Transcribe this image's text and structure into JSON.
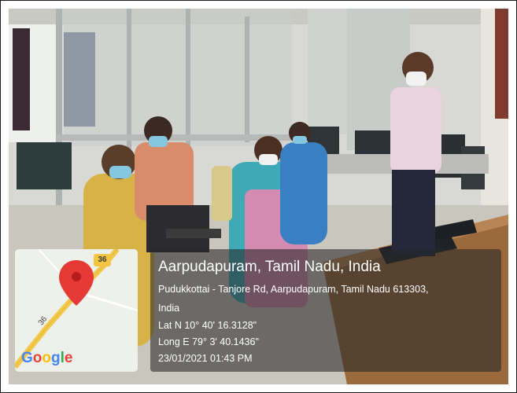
{
  "geotag": {
    "place_title": "Aarpudapuram, Tamil Nadu, India",
    "address_line_1": "Pudukkottai - Tanjore Rd, Aarpudapuram, Tamil Nadu 613303,",
    "address_line_2": "India",
    "latitude": "Lat N 10° 40' 16.3128\"",
    "longitude": "Long E 79° 3' 40.1436\"",
    "timestamp": "23/01/2021 01:43 PM"
  },
  "map": {
    "route_number_top": "36",
    "route_number_diag": "36",
    "logo_letters": [
      "G",
      "o",
      "o",
      "g",
      "l",
      "e"
    ],
    "logo_colors": [
      "#4285F4",
      "#EA4335",
      "#FBBC05",
      "#4285F4",
      "#34A853",
      "#EA4335"
    ],
    "pin_color": "#E53935",
    "road_color": "#F2C94C"
  }
}
